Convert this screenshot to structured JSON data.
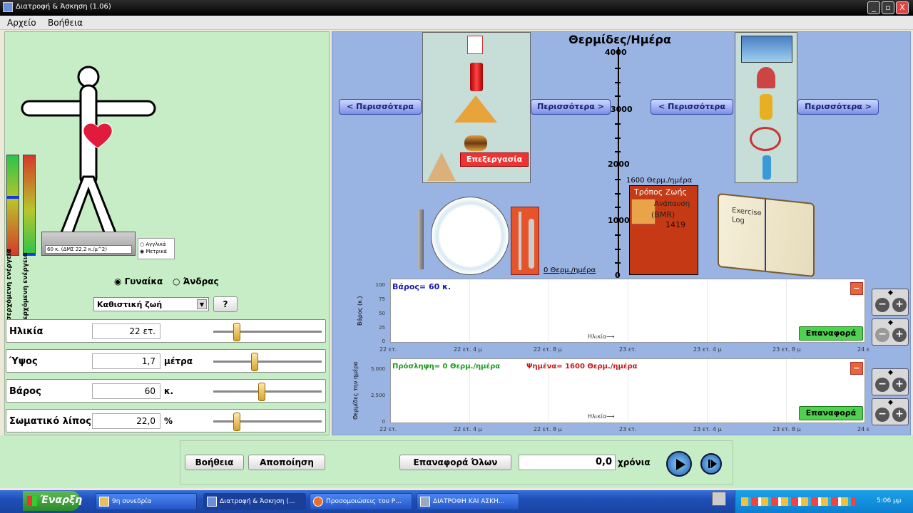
{
  "window": {
    "title": "Διατροφή & Άσκηση (1.06)",
    "min": "_",
    "max": "▫",
    "close": "X"
  },
  "menu": {
    "file": "Αρχείο",
    "help": "Βοήθεια"
  },
  "left": {
    "bmi_label": "60 κ. (ΔΜΣ 22,2 κ./μ^2)",
    "units": {
      "english": "Αγγλικά",
      "metric": "Μετρικά"
    },
    "bar_labels": {
      "left": "Εισερχόμενη ενέργεια",
      "right": "Εξερχόμενη ενέργεια"
    },
    "gender": {
      "female": "Γυναίκα",
      "male": "Άνδρας",
      "selected": "female"
    },
    "lifestyle": {
      "value": "Καθιστική ζωή",
      "help": "?"
    },
    "rows": [
      {
        "label": "Ηλικία",
        "value": "22 ετ.",
        "unit": ""
      },
      {
        "label": "Ύψος",
        "value": "1,7",
        "unit": "μέτρα"
      },
      {
        "label": "Βάρος",
        "value": "60",
        "unit": "κ."
      },
      {
        "label": "Σωματικό λίπος",
        "value": "22,0",
        "unit": "%"
      }
    ]
  },
  "center": {
    "more_left": "< Περισσότερα",
    "more_right": "Περισσότερα >",
    "edit": "Επεξεργασία",
    "plate_label": "0 Θερμ./ημέρα",
    "more_left2": "< Περισσότερα",
    "more_right2": "Περισσότερα >",
    "chart_title": "Θερμίδες/Ημέρα",
    "y_ticks": [
      "4000",
      "3000",
      "2000",
      "1000",
      "0"
    ],
    "bar_top_label": "1600 Θερμ./ημέρα",
    "bar_title": "Τρόπος Ζωής",
    "bar_sub1": "Ανάπαυση",
    "bar_sub2": "(BMR)",
    "bar_value": "1419",
    "log_text": "Exercise Log"
  },
  "graph1": {
    "text": "Βάρος= 60 κ.",
    "ylabel": "Βάρος (κ.)",
    "y": [
      "100",
      "75",
      "50",
      "25",
      "0"
    ],
    "xlabel": "Ηλικία",
    "reset": "Επαναφορά",
    "xt": [
      "22 ετ.",
      "22 ετ. 4 μ",
      "22 ετ. 8 μ",
      "23 ετ.",
      "23 ετ. 4 μ",
      "23 ετ. 8 μ",
      "24 ε"
    ]
  },
  "graph2": {
    "text1": "Πρόσληψη= 0 Θερμ./ημέρα",
    "text2": "Ψημένα= 1600 Θερμ./ημέρα",
    "ylabel": "Θερμίδες την ημέρα",
    "y": [
      "5.000",
      "2.500",
      "0"
    ],
    "xlabel": "Ηλικία",
    "reset": "Επαναφορά",
    "xt": [
      "22 ετ.",
      "22 ετ. 4 μ",
      "22 ετ. 8 μ",
      "23 ετ.",
      "23 ετ. 4 μ",
      "23 ετ. 8 μ",
      "24 ε"
    ]
  },
  "bottom": {
    "help": "Βοήθεια",
    "exit": "Αποποίηση",
    "reset_all": "Επαναφορά Όλων",
    "time_value": "0,0",
    "time_unit": "χρόνια"
  },
  "taskbar": {
    "start": "Έναρξη",
    "items": [
      "9η συνεδρία",
      "Διατροφή & Άσκηση (...",
      "Προσομοιώσεις του Ρ...",
      "ΔΙΑΤΡΟΦΗ ΚΑΙ ΑΣΚΗ..."
    ],
    "clock": "5:06 μμ"
  },
  "colors": {
    "left_bg": "#c6edc6",
    "right_bg": "#99b3e3",
    "accent_blue": "#7d8fe6"
  }
}
